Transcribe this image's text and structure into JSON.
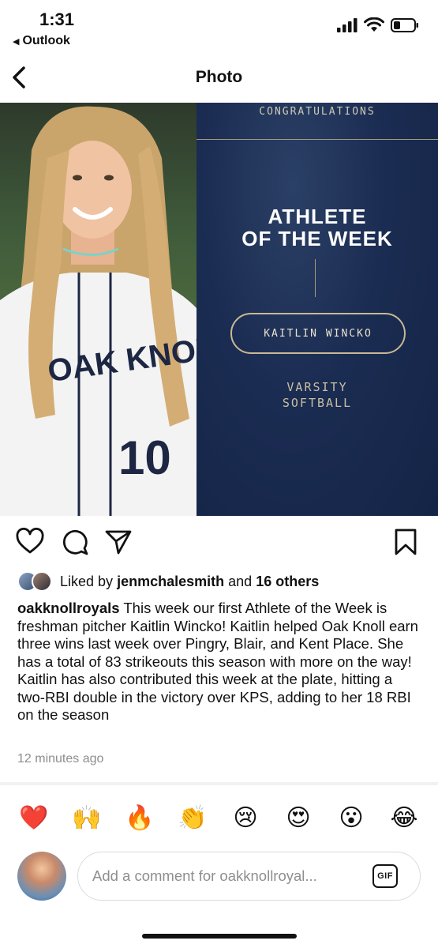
{
  "status_bar": {
    "time": "1:31",
    "back_app": "Outlook"
  },
  "nav": {
    "title": "Photo"
  },
  "post_image": {
    "congrats": "CONGRATULATIONS",
    "headline_line1": "ATHLETE",
    "headline_line2": "OF THE WEEK",
    "athlete_name": "KAITLIN WINCKO",
    "sport_line1": "VARSITY",
    "sport_line2": "SOFTBALL",
    "jersey_text": "OAK KNOLL",
    "jersey_number": "10"
  },
  "likes": {
    "prefix": "Liked by",
    "user": "jenmchalesmith",
    "middle": "and",
    "others": "16 others"
  },
  "caption": {
    "username": "oakknollroyals",
    "text": "This week our first Athlete of the Week is freshman pitcher Kaitlin Wincko! Kaitlin helped Oak Knoll earn three wins last week over Pingry, Blair, and Kent Place. She has a total of 83 strikeouts this season with more on the way! Kaitlin has also contributed this week at the plate, hitting a two-RBI double in the victory over KPS, adding to her 18 RBI on the season"
  },
  "timestamp": "12 minutes ago",
  "reactions": [
    "❤️",
    "🙌",
    "🔥",
    "👏",
    "😢",
    "😍",
    "😮",
    "😂"
  ],
  "comment": {
    "placeholder": "Add a comment for oakknollroyal...",
    "gif_label": "GIF"
  }
}
